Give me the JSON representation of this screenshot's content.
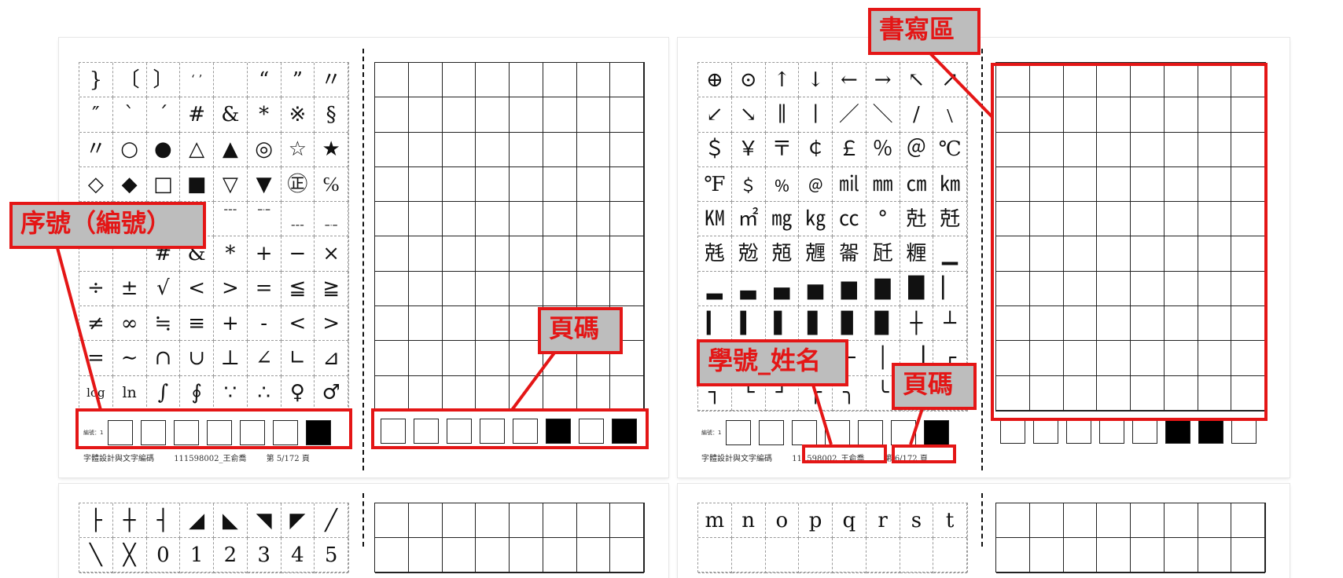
{
  "sheets": [
    {
      "glyph_rows": [
        [
          "}",
          "〔",
          "〕",
          "‘ ’",
          "",
          "“",
          "”",
          "〃"
        ],
        [
          "″",
          "ˋ",
          "ˊ",
          "#",
          "&",
          "*",
          "※",
          "§"
        ],
        [
          "〃",
          "○",
          "●",
          "△",
          "▲",
          "◎",
          "☆",
          "★"
        ],
        [
          "◇",
          "◆",
          "□",
          "■",
          "▽",
          "▼",
          "㊣",
          "℅"
        ],
        [
          "",
          "",
          "",
          "",
          "﹉",
          "﹊",
          "﹍",
          "﹎"
        ],
        [
          "",
          "",
          "#",
          "&",
          "*",
          "+",
          "−",
          "×"
        ],
        [
          "÷",
          "±",
          "√",
          "<",
          ">",
          "=",
          "≦",
          "≧"
        ],
        [
          "≠",
          "∞",
          "≒",
          "≡",
          "+",
          "-",
          "<",
          ">"
        ],
        [
          "=",
          "∼",
          "∩",
          "∪",
          "⊥",
          "∠",
          "∟",
          "⊿"
        ],
        [
          "log",
          "ln",
          "∫",
          "∮",
          "∵",
          "∴",
          "♀",
          "♂"
        ]
      ],
      "code_label": "編號：1",
      "code_bits": [
        0,
        0,
        0,
        0,
        0,
        0,
        1
      ],
      "right_code_bits": [
        0,
        0,
        0,
        0,
        0,
        1,
        0,
        1
      ],
      "footer": {
        "course": "字體設計與文字編碼",
        "student": "111598002_王俞喬",
        "page": "第  5/172  頁"
      }
    },
    {
      "glyph_rows": [
        [
          "⊕",
          "⊙",
          "↑",
          "↓",
          "←",
          "→",
          "↖",
          "↗"
        ],
        [
          "↙",
          "↘",
          "∥",
          "∣",
          "／",
          "＼",
          "∕",
          "﹨"
        ],
        [
          "＄",
          "￥",
          "〒",
          "￠",
          "￡",
          "％",
          "＠",
          "℃"
        ],
        [
          "℉",
          "﹩",
          "﹪",
          "﹫",
          "㏕",
          "㎜",
          "㎝",
          "㎞"
        ],
        [
          "㏎",
          "㎡",
          "㎎",
          "㎏",
          "㏄",
          "°",
          "兙",
          "兛"
        ],
        [
          "兞",
          "兝",
          "兡",
          "兣",
          "嗧",
          "瓩",
          "糎",
          "▁"
        ],
        [
          "▂",
          "▃",
          "▄",
          "▅",
          "▆",
          "▇",
          "█",
          "▏"
        ],
        [
          "▎",
          "▍",
          "▌",
          "▋",
          "▊",
          "▉",
          "┼",
          "┴"
        ],
        [
          "┬",
          "┤",
          "├",
          "▔",
          "─",
          "│",
          "▕",
          "┌"
        ],
        [
          "┐",
          "└",
          "┘",
          "╭",
          "╮",
          "╰",
          "╯",
          "═"
        ]
      ],
      "code_label": "編號：1",
      "code_bits": [
        0,
        0,
        0,
        0,
        0,
        0,
        1
      ],
      "right_code_bits": [
        0,
        0,
        0,
        0,
        0,
        1,
        1,
        0
      ],
      "footer": {
        "course": "字體設計與文字編碼",
        "student": "111598002_王俞喬",
        "page": "第  6/172  頁"
      }
    },
    {
      "glyph_rows": [
        [
          "├",
          "┼",
          "┤",
          "◢",
          "◣",
          "◥",
          "◤",
          "╱"
        ],
        [
          "╲",
          "╳",
          "0",
          "1",
          "2",
          "3",
          "4",
          "5"
        ]
      ]
    },
    {
      "glyph_rows": [
        [
          "m",
          "n",
          "o",
          "p",
          "q",
          "r",
          "s",
          "t"
        ],
        [
          "",
          "",
          "",
          "",
          "",
          "",
          "",
          ""
        ]
      ]
    }
  ],
  "annotations": {
    "serial_label": "序號（編號）",
    "page_label_1": "頁碼",
    "student_label": "學號_姓名",
    "page_label_2": "頁碼",
    "writing_area_label": "書寫區"
  }
}
